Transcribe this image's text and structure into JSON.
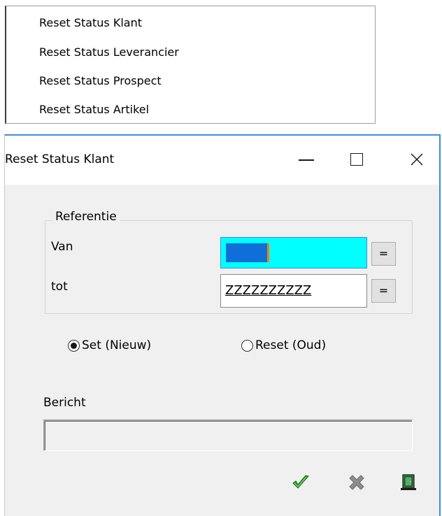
{
  "menu": {
    "items": [
      {
        "label": "Reset Status Klant"
      },
      {
        "label": "Reset Status Leverancier"
      },
      {
        "label": "Reset Status Prospect"
      },
      {
        "label": "Reset Status Artikel"
      }
    ]
  },
  "dialog": {
    "title": "Reset Status Klant",
    "group": {
      "title": "Referentie",
      "van_label": "Van",
      "tot_label": "tot",
      "van_value": "",
      "tot_value": "ZZZZZZZZZZ",
      "lookup_button_label": "="
    },
    "options": {
      "set_label": "Set (Nieuw)",
      "reset_label": "Reset (Oud)",
      "selected": "set"
    },
    "message": {
      "label": "Bericht",
      "value": ""
    },
    "toolbar": {
      "ok_icon": "checkmark-icon",
      "cancel_icon": "cancel-x-icon",
      "exit_icon": "exit-door-icon"
    }
  },
  "colors": {
    "accent": "#3c8ee0",
    "van_field_bg": "#00ffff",
    "selection": "#0f6fd8",
    "cursor": "#ff8000",
    "dialog_bg": "#f0f0f0",
    "ok_green": "#2e9e2e",
    "cancel_gray": "#8c8c8c"
  }
}
